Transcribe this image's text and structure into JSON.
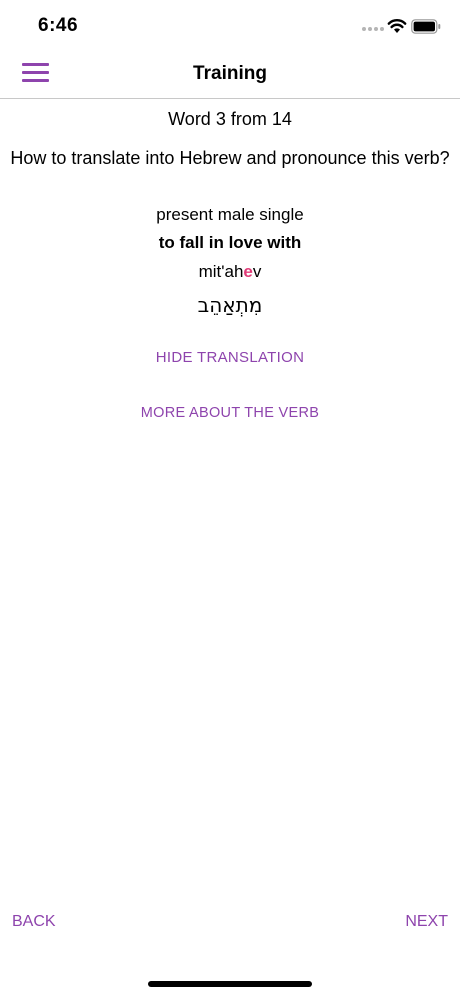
{
  "status_bar": {
    "time": "6:46",
    "icons": [
      "signal-icon",
      "wifi-icon",
      "battery-icon"
    ]
  },
  "nav": {
    "title": "Training",
    "menu_icon": "hamburger-menu-icon"
  },
  "training": {
    "counter": "Word 3 from 14",
    "question": "How to translate into Hebrew and pronounce this verb?",
    "verb_form": "present male single",
    "verb_english": "to fall in love with",
    "transliteration_before": "mit'ah",
    "transliteration_stress": "e",
    "transliteration_after": "v",
    "hebrew": "מִתְאַהֵב"
  },
  "actions": {
    "hide_translation": "HIDE TRANSLATION",
    "more_about": "MORE ABOUT THE VERB",
    "back": "BACK",
    "next": "NEXT"
  },
  "colors": {
    "accent": "#8e44ad",
    "stress": "#e03c78"
  }
}
